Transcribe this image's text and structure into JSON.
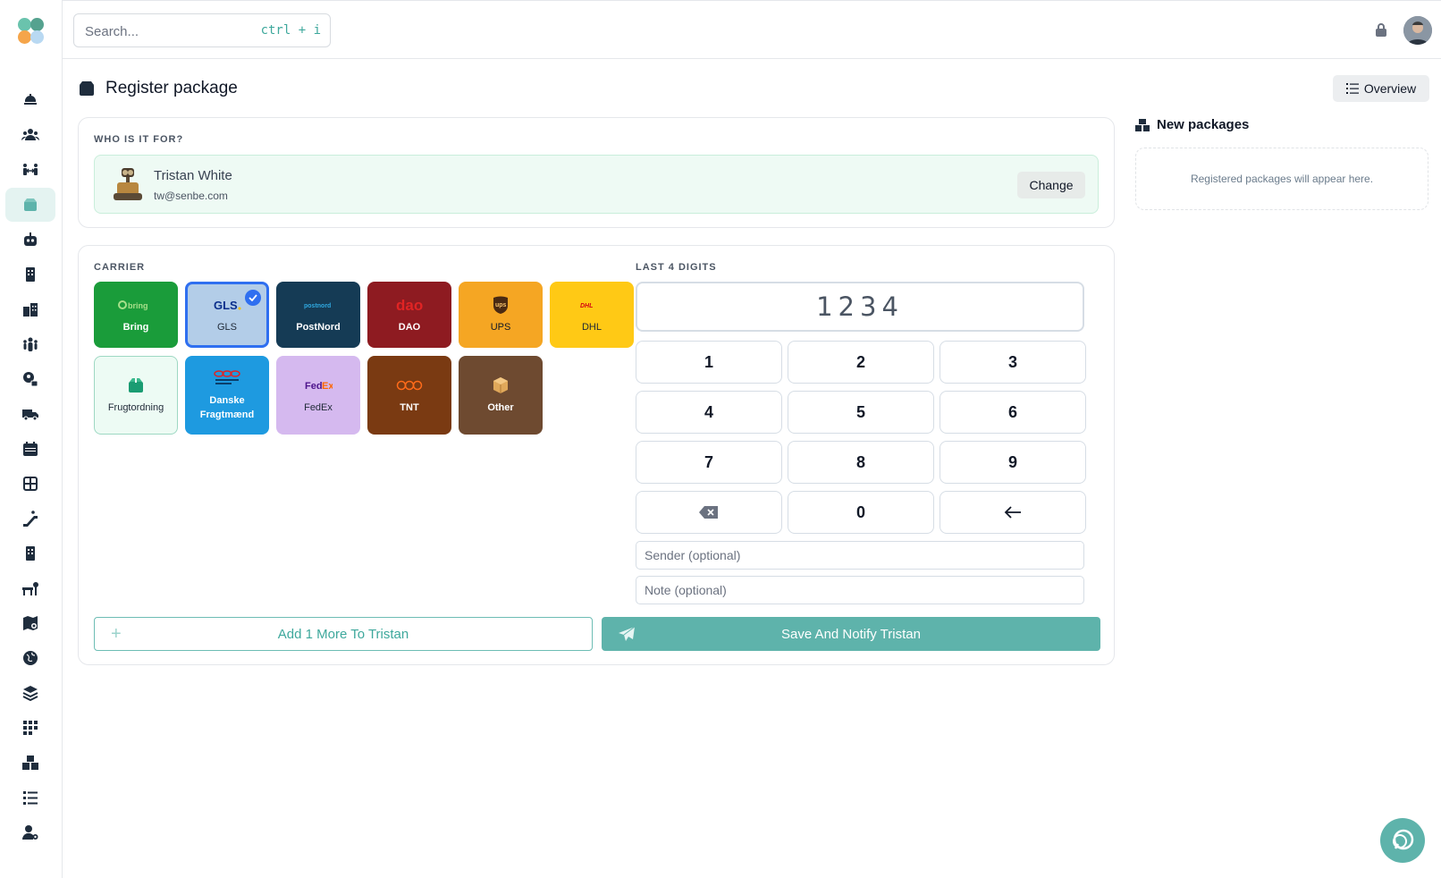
{
  "search": {
    "placeholder": "Search...",
    "shortcut": "ctrl + i"
  },
  "page": {
    "title": "Register package",
    "overview_label": "Overview"
  },
  "recipient": {
    "section_label": "WHO IS IT FOR?",
    "name": "Tristan White",
    "email": "tw@senbe.com",
    "change_label": "Change"
  },
  "carrier": {
    "section_label": "CARRIER",
    "items": [
      {
        "label": "Bring",
        "logo": "bring",
        "bg": "#1a9c3a",
        "selected": false
      },
      {
        "label": "GLS",
        "logo": "GLS",
        "bg": "#b3cde8",
        "selected": true
      },
      {
        "label": "PostNord",
        "logo": "postnord",
        "bg": "#153b55",
        "selected": false
      },
      {
        "label": "DAO",
        "logo": "dao",
        "bg": "#8e1b21",
        "selected": false
      },
      {
        "label": "UPS",
        "logo": "ups",
        "bg": "#f5a623",
        "selected": false
      },
      {
        "label": "DHL",
        "logo": "DHL",
        "bg": "#ffc915",
        "selected": false
      },
      {
        "label": "Frugtordning",
        "logo": "box-icon",
        "bg": "#edfbf4",
        "selected": false
      },
      {
        "label": "Danske Fragtmænd",
        "logo": "DF",
        "bg": "#1e9ae0",
        "selected": false
      },
      {
        "label": "FedEx",
        "logo": "FedEx",
        "bg": "#d5b9ef",
        "selected": false
      },
      {
        "label": "TNT",
        "logo": "TNT",
        "bg": "#7a3a12",
        "selected": false
      },
      {
        "label": "Other",
        "logo": "package-icon",
        "bg": "#6e4a30",
        "selected": false
      }
    ]
  },
  "digits": {
    "section_label": "LAST 4 DIGITS",
    "value": "1234",
    "keys": [
      "1",
      "2",
      "3",
      "4",
      "5",
      "6",
      "7",
      "8",
      "9",
      "",
      "0",
      ""
    ]
  },
  "sender": {
    "placeholder": "Sender (optional)"
  },
  "note": {
    "placeholder": "Note (optional)"
  },
  "actions": {
    "add_more_label": "Add 1 More To Tristan",
    "save_label": "Save And Notify Tristan"
  },
  "new_packages": {
    "title": "New packages",
    "empty_text": "Registered packages will appear here."
  },
  "colors": {
    "accent": "#5eb3ab",
    "accent_text": "#3ea89c",
    "selected_border": "#2f6ff0"
  }
}
